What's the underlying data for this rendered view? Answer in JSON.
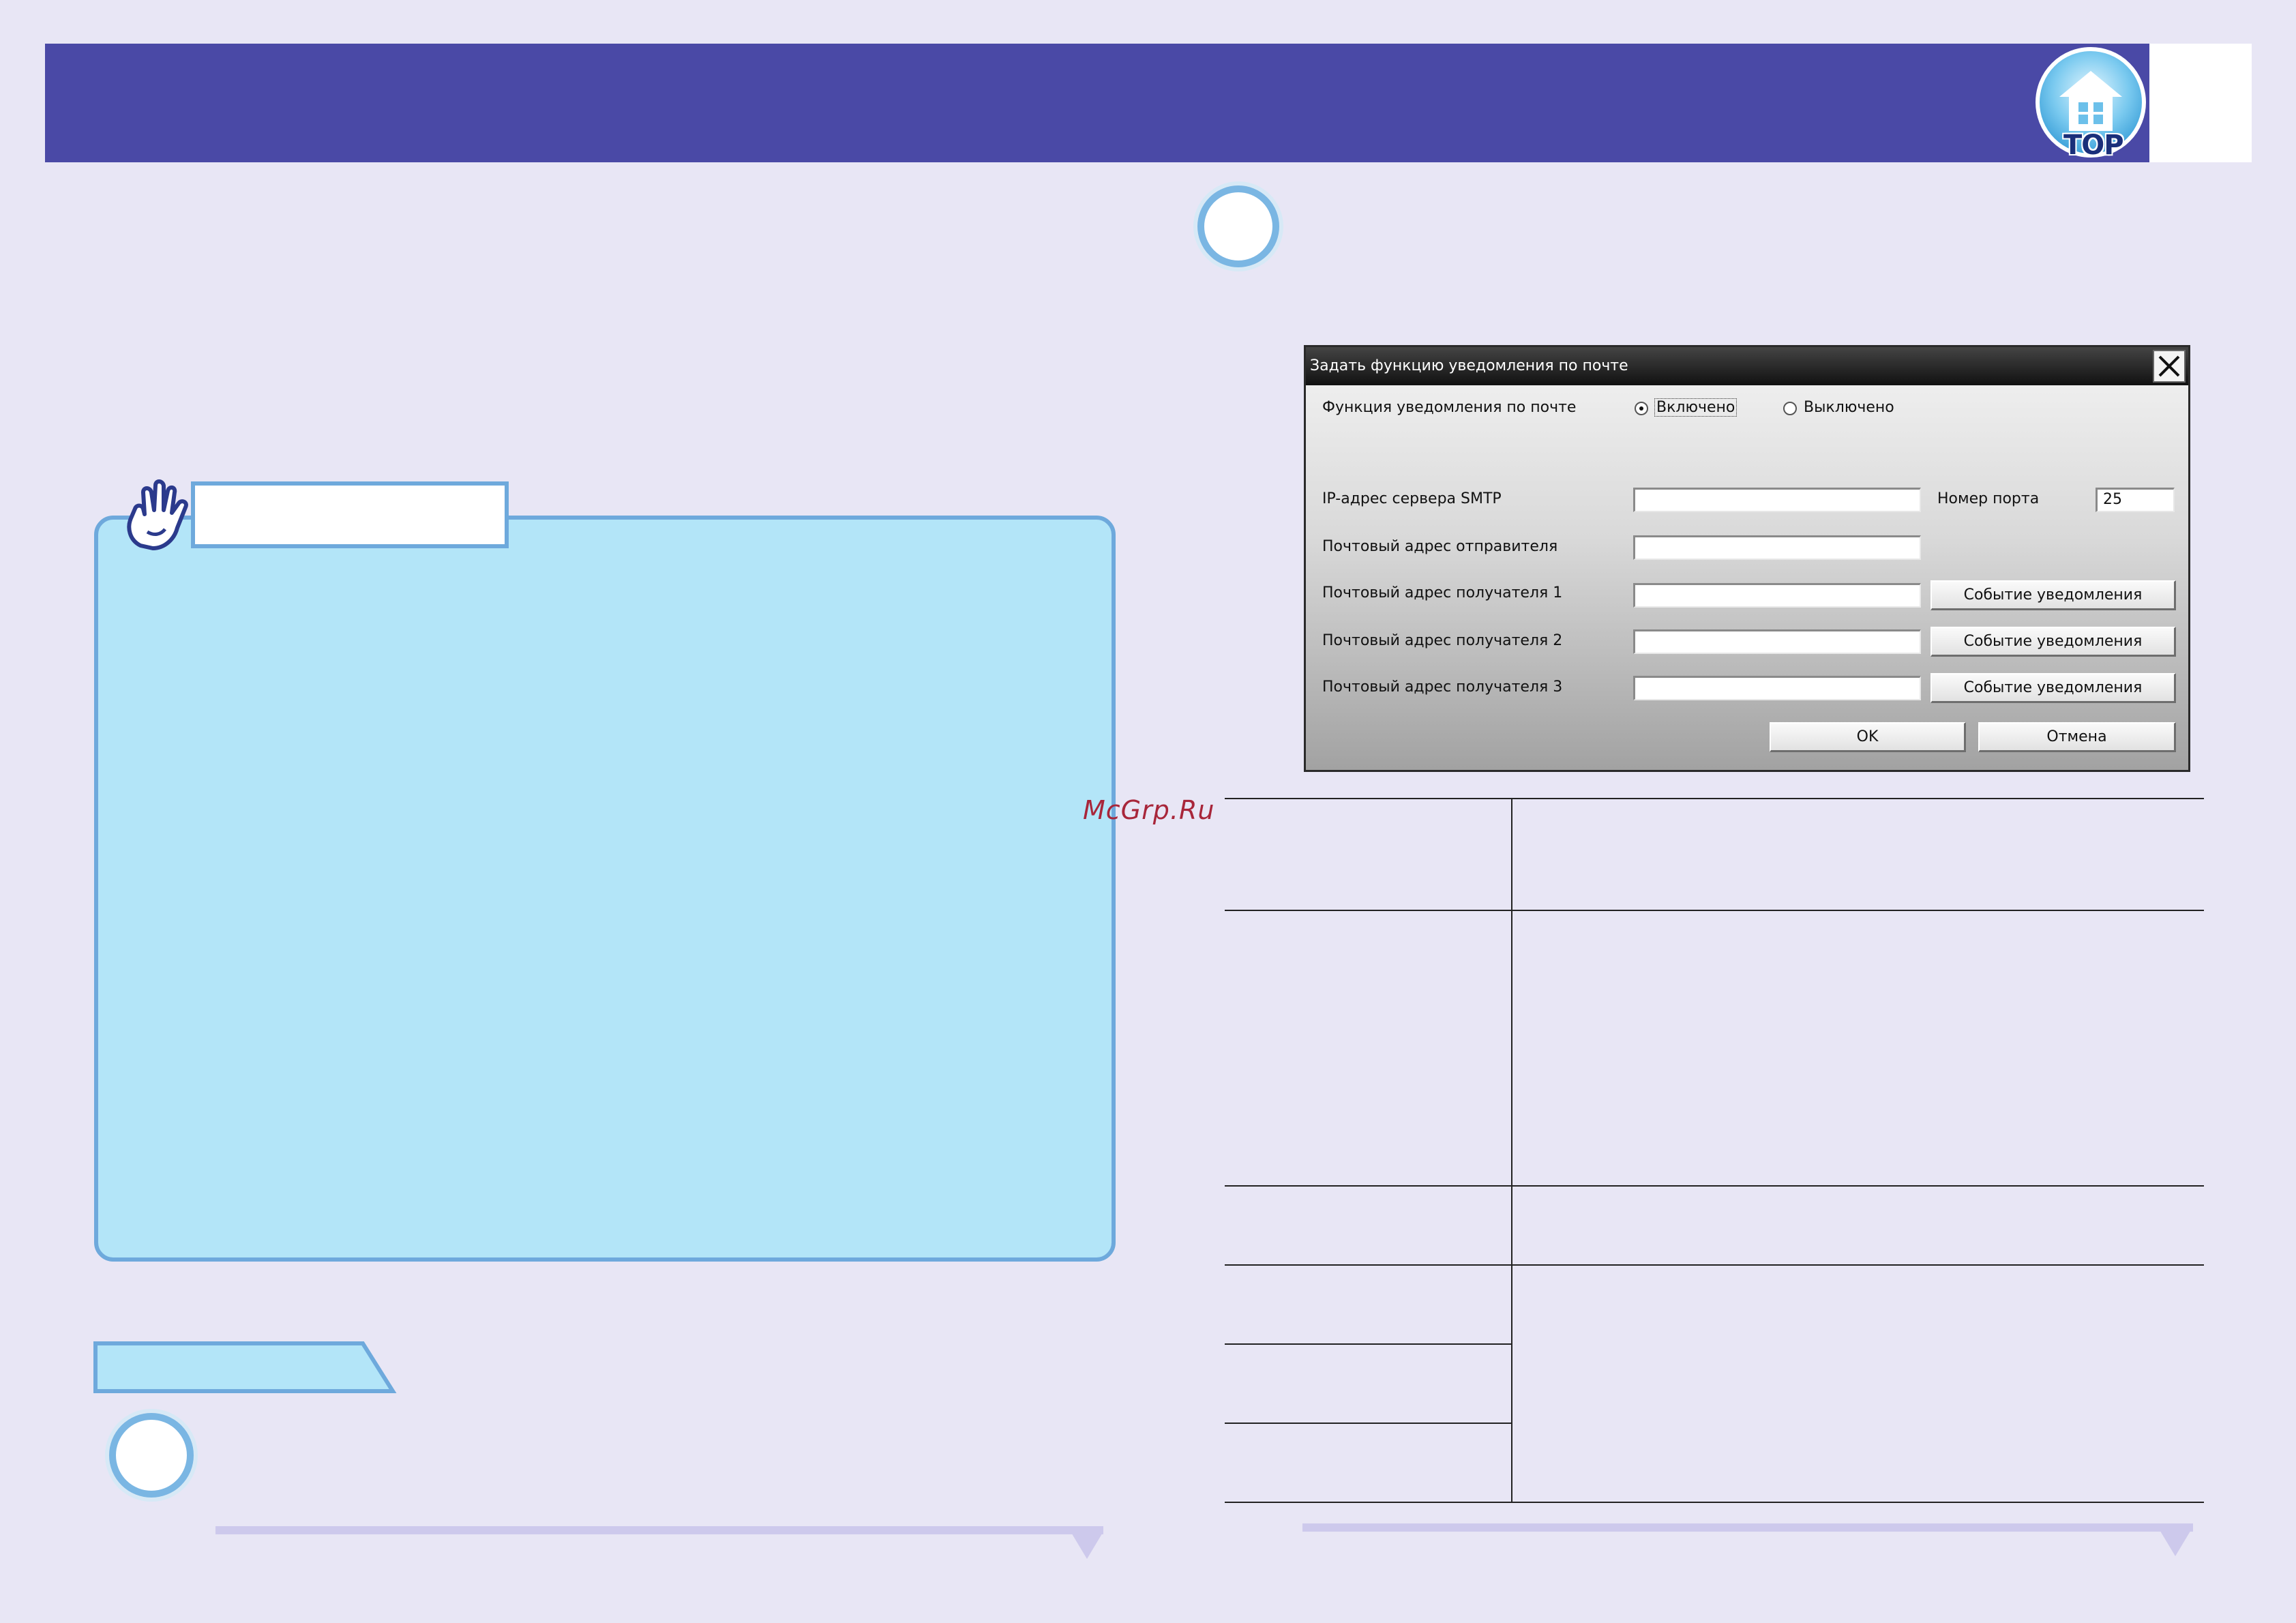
{
  "header": {
    "top_button_label": "TOP",
    "colors": {
      "bar": "#4a49a6",
      "page": "#e8e6f5",
      "note": "#b3e5f8",
      "accent": "#6ea9dc"
    }
  },
  "watermark": "McGrp.Ru",
  "icons": [
    "home-icon",
    "pointing-hand-icon",
    "close-icon",
    "radio-selected-icon",
    "radio-unselected-icon"
  ],
  "dialog": {
    "title": "Задать функцию уведомления по почте",
    "notification_label": "Функция уведомления по почте",
    "radio_on": "Включено",
    "radio_off": "Выключено",
    "radio_selected": "Включено",
    "smtp_label": "IP-адрес сервера SMTP",
    "smtp_value": "",
    "port_label": "Номер порта",
    "port_value": "25",
    "sender_label": "Почтовый адрес отправителя",
    "sender_value": "",
    "recipients": [
      {
        "label": "Почтовый адрес получателя 1",
        "value": "",
        "button": "Событие уведомления"
      },
      {
        "label": "Почтовый адрес получателя 2",
        "value": "",
        "button": "Событие уведомления"
      },
      {
        "label": "Почтовый адрес получателя 3",
        "value": "",
        "button": "Событие уведомления"
      }
    ],
    "ok_label": "OK",
    "cancel_label": "Отмена"
  }
}
